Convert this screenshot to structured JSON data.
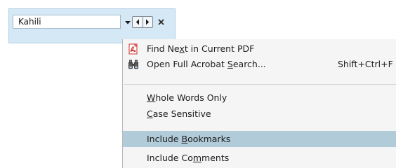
{
  "find_bar": {
    "search_value": "Kahili",
    "icons": {
      "dropdown": "chevron-down-icon",
      "prev": "previous-arrow-icon",
      "next": "next-arrow-icon",
      "close": "close-icon"
    }
  },
  "menu": {
    "items": [
      {
        "label_pre": "Find Ne",
        "label_u": "x",
        "label_post": "t in Current PDF",
        "icon": "pdf-icon",
        "shortcut": ""
      },
      {
        "label_pre": "Open Full Acrobat ",
        "label_u": "S",
        "label_post": "earch...",
        "icon": "binoculars-icon",
        "shortcut": "Shift+Ctrl+F"
      },
      {
        "label_pre": "",
        "label_u": "W",
        "label_post": "hole Words Only",
        "icon": "",
        "shortcut": ""
      },
      {
        "label_pre": "",
        "label_u": "C",
        "label_post": "ase Sensitive",
        "icon": "",
        "shortcut": ""
      },
      {
        "label_pre": "Include ",
        "label_u": "B",
        "label_post": "ookmarks",
        "icon": "",
        "shortcut": "",
        "highlighted": true
      },
      {
        "label_pre": "Include Co",
        "label_u": "m",
        "label_post": "ments",
        "icon": "",
        "shortcut": ""
      }
    ]
  },
  "colors": {
    "find_bar_bg": "#d4e8f5",
    "menu_bg": "#f5f5f5",
    "highlight": "#b2cbd9"
  }
}
